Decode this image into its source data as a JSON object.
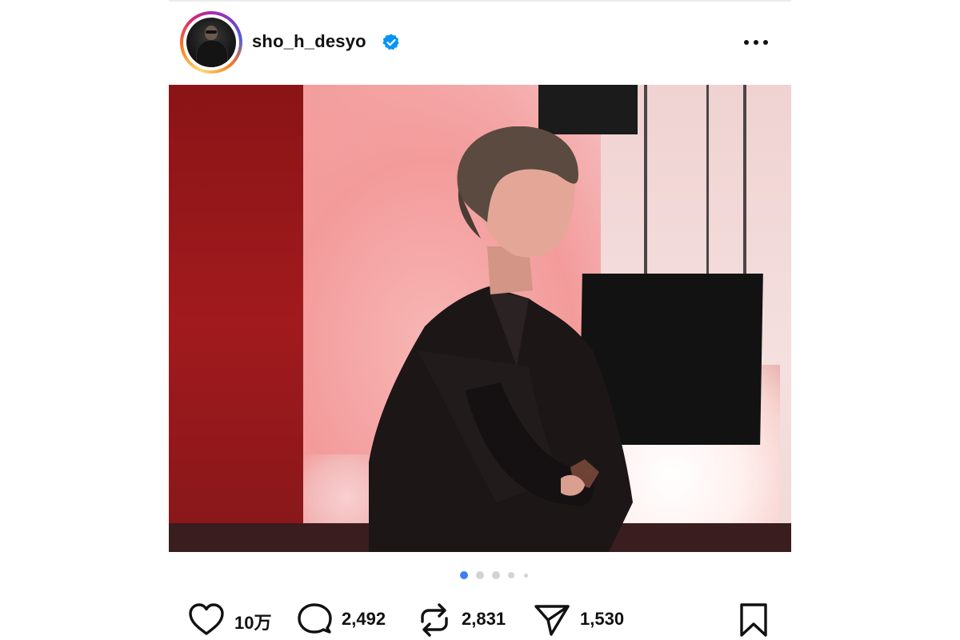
{
  "post": {
    "username": "sho_h_desyo",
    "verified": true,
    "carousel": {
      "total": 5,
      "active": 1
    },
    "actions": {
      "likes": "10万",
      "comments": "2,492",
      "reposts": "2,831",
      "shares": "1,530"
    },
    "icons": {
      "more": "more-options-icon",
      "like": "heart-icon",
      "comment": "comment-bubble-icon",
      "repost": "repost-icon",
      "share": "paper-plane-icon",
      "save": "bookmark-icon",
      "verified": "verified-badge-icon"
    },
    "colors": {
      "accent_blue": "#0095f6",
      "active_dot": "#3f7cf5",
      "text": "#111111"
    }
  }
}
